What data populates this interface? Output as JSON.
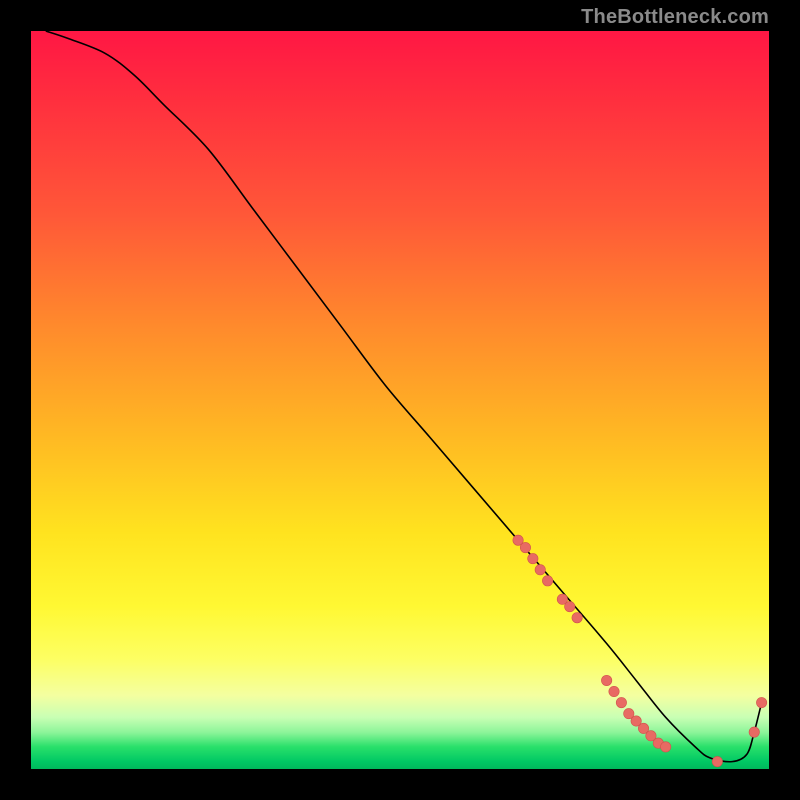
{
  "watermark": "TheBottleneck.com",
  "colors": {
    "line": "#000000",
    "point_fill": "#e86a63",
    "point_stroke": "#d2534c",
    "background": "#000000"
  },
  "chart_data": {
    "type": "line",
    "title": "",
    "xlabel": "",
    "ylabel": "",
    "xlim": [
      0,
      100
    ],
    "ylim": [
      0,
      100
    ],
    "grid": false,
    "legend": false,
    "series": [
      {
        "name": "curve",
        "kind": "line",
        "x": [
          2,
          5,
          10,
          14,
          18,
          24,
          30,
          36,
          42,
          48,
          54,
          60,
          66,
          72,
          78,
          82,
          86,
          90,
          92,
          95,
          97,
          98,
          99
        ],
        "y": [
          100,
          99,
          97,
          94,
          90,
          84,
          76,
          68,
          60,
          52,
          45,
          38,
          31,
          24,
          17,
          12,
          7,
          3,
          1.5,
          1,
          2,
          5,
          9
        ]
      },
      {
        "name": "points",
        "kind": "scatter",
        "x": [
          66,
          67,
          68,
          69,
          70,
          72,
          73,
          74,
          78,
          79,
          80,
          81,
          82,
          83,
          84,
          85,
          86,
          93,
          98,
          99
        ],
        "y": [
          31,
          30,
          28.5,
          27,
          25.5,
          23,
          22,
          20.5,
          12,
          10.5,
          9,
          7.5,
          6.5,
          5.5,
          4.5,
          3.5,
          3,
          1,
          5,
          9
        ]
      }
    ]
  }
}
